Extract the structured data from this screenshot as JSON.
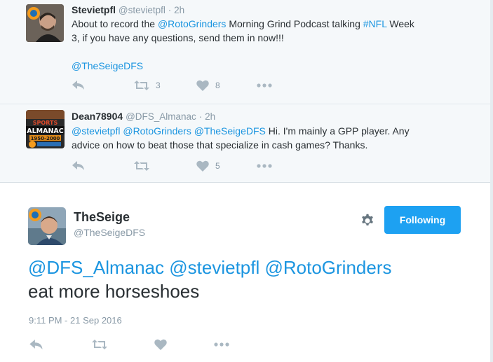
{
  "replies": [
    {
      "fullname": "Stevietpfl",
      "handle": "@stevietpfl",
      "dot": "·",
      "time": "2h",
      "text_parts": {
        "p1": "About to record the ",
        "mention1": "@RotoGrinders",
        "p2": " Morning Grind Podcast talking ",
        "hashtag": "#NFL",
        "p3": " Week",
        "line2": "3, if you have any questions, send them in now!!!",
        "mention2": "@TheSeigeDFS"
      },
      "retweets": "3",
      "likes": "8"
    },
    {
      "fullname": "Dean78904",
      "handle": "@DFS_Almanac",
      "dot": "·",
      "time": "2h",
      "text_parts": {
        "mention1": "@stevietpfl",
        "mention2": "@RotoGrinders",
        "mention3": "@TheSeigeDFS",
        "p1": " Hi. I'm mainly a GPP player. Any",
        "line2": "advice on how to beat those that specialize in cash games? Thanks."
      },
      "retweets": "",
      "likes": "5",
      "avatar_text": {
        "line1": "SPORTS",
        "line2": "ALMANAC",
        "line3": "1950-2000"
      }
    }
  ],
  "main": {
    "fullname": "TheSeige",
    "handle": "@TheSeigeDFS",
    "follow_label": "Following",
    "mention1": "@DFS_Almanac",
    "mention2": "@stevietpfl",
    "mention3": "@RotoGrinders",
    "line2": "eat more horseshoes",
    "timestamp": "9:11 PM - 21 Sep 2016"
  },
  "colors": {
    "link": "#1b95e0",
    "follow_button": "#1da1f2",
    "reply_bg": "#f5f8fa",
    "muted": "#8899a6",
    "icon": "#aab8c2"
  },
  "icons": [
    "reply-icon",
    "retweet-icon",
    "heart-icon",
    "more-icon",
    "gear-icon"
  ]
}
